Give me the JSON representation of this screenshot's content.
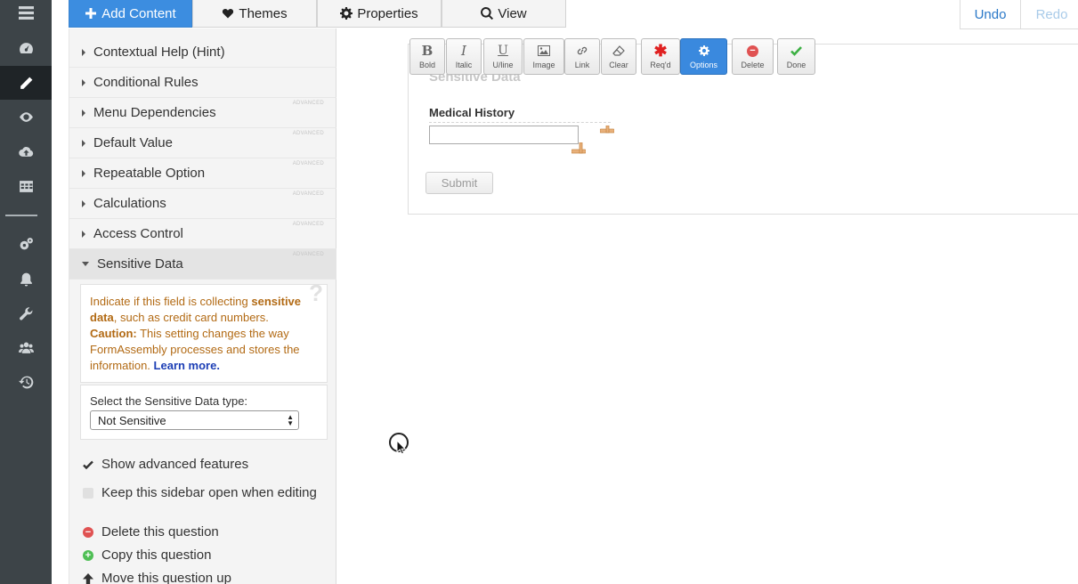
{
  "rail": {
    "icons": [
      "list-icon",
      "dashboard-icon",
      "pencil-icon",
      "eye-icon",
      "cloud-upload-icon",
      "table-icon",
      "gears-icon",
      "bell-icon",
      "wrench-icon",
      "users-icon",
      "history-icon"
    ],
    "active": "pencil-icon"
  },
  "tabs": {
    "add_content": "Add Content",
    "themes": "Themes",
    "properties": "Properties",
    "view": "View"
  },
  "history": {
    "undo": "Undo",
    "redo": "Redo"
  },
  "sidebar": {
    "sections": [
      {
        "label": "Contextual Help (Hint)",
        "advanced": ""
      },
      {
        "label": "Conditional Rules",
        "advanced": ""
      },
      {
        "label": "Menu Dependencies",
        "advanced": "ADVANCED"
      },
      {
        "label": "Default Value",
        "advanced": "ADVANCED"
      },
      {
        "label": "Repeatable Option",
        "advanced": "ADVANCED"
      },
      {
        "label": "Calculations",
        "advanced": "ADVANCED"
      },
      {
        "label": "Access Control",
        "advanced": "ADVANCED"
      },
      {
        "label": "Sensitive Data",
        "advanced": "ADVANCED"
      }
    ],
    "hint": {
      "intro": "Indicate if this field is collecting ",
      "strong": "sensitive data",
      "after": ", such as credit card numbers.",
      "caution_label": "Caution:",
      "caution_text": " This setting changes the way FormAssembly processes and stores the information. ",
      "learn_more": "Learn more.",
      "help_mark": "?"
    },
    "sensitive_type": {
      "label": "Select the Sensitive Data type:",
      "selected": "Not Sensitive"
    },
    "show_advanced": "Show advanced features",
    "keep_open": "Keep this sidebar open when editing",
    "actions": {
      "delete": "Delete this question",
      "copy": "Copy this question",
      "move_up": "Move this question up"
    }
  },
  "toolbar": {
    "bold": "Bold",
    "italic": "Italic",
    "underline": "U/line",
    "image": "Image",
    "link": "Link",
    "clear": "Clear",
    "required": "Req'd",
    "options": "Options",
    "delete": "Delete",
    "done": "Done"
  },
  "form": {
    "section_title": "Sensitive Data",
    "field_label": "Medical History",
    "field_value": "",
    "submit": "Submit"
  },
  "colors": {
    "rail": "#3d4448",
    "accent": "#3c8de0",
    "hint_text": "#b26a14",
    "link": "#1d3fb5"
  }
}
